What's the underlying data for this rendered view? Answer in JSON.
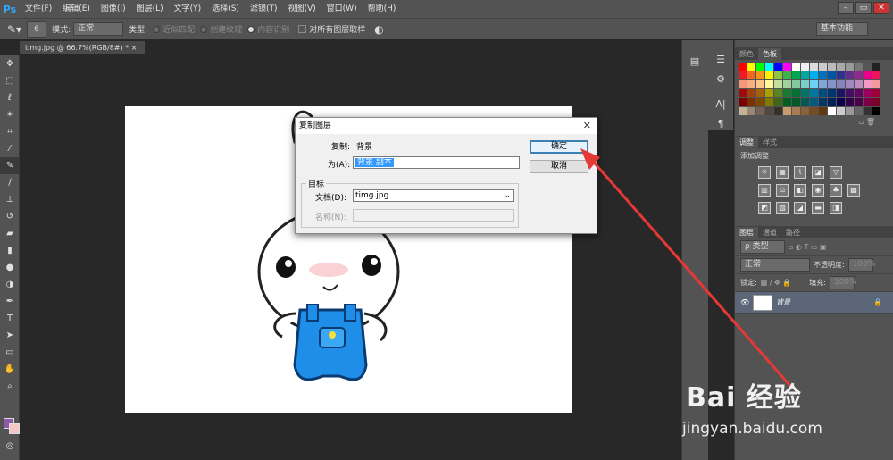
{
  "app": {
    "logo": "Ps"
  },
  "menu": [
    "文件(F)",
    "编辑(E)",
    "图像(I)",
    "图层(L)",
    "文字(Y)",
    "选择(S)",
    "滤镜(T)",
    "视图(V)",
    "窗口(W)",
    "帮助(H)"
  ],
  "window_controls": {
    "min": "–",
    "max": "▭",
    "close": "✕"
  },
  "options": {
    "brush_size": "6",
    "mode_label": "模式:",
    "mode_value": "正常",
    "type_label": "类型:",
    "opt1": "近似匹配",
    "opt2": "创建纹理",
    "opt3": "内容识别",
    "sample_all": "对所有图层取样",
    "workspace": "基本功能"
  },
  "document_tab": "timg.jpg @ 66.7%(RGB/8#) * ×",
  "panels": {
    "color_tabs": [
      "颜色",
      "色板"
    ],
    "adjust_tabs": [
      "调整",
      "样式"
    ],
    "adjust_label": "添加调整",
    "layers_tabs": [
      "图层",
      "通道",
      "路径"
    ],
    "layer_filter": "ρ 类型",
    "blend_mode": "正常",
    "opacity_label": "不透明度:",
    "opacity_value": "100%",
    "lock_label": "锁定:",
    "fill_label": "填充:",
    "fill_value": "100%",
    "layer_name": "背景"
  },
  "dialog": {
    "title": "复制图层",
    "copy_label": "复制:",
    "copy_value": "背景",
    "as_label": "为(A):",
    "as_value": "背景 副本",
    "target_label": "目标",
    "doc_label": "文档(D):",
    "doc_value": "timg.jpg",
    "name_label": "名称(N):",
    "name_value": "",
    "ok_label": "确定",
    "cancel_label": "取消"
  },
  "watermark": {
    "logo": "Bai 经验",
    "url": "jingyan.baidu.com"
  },
  "colors": {
    "accent": "#31a8ff",
    "arrow": "#e53935",
    "fg": "#8d5aa9",
    "bg": "#f3c7c6"
  }
}
